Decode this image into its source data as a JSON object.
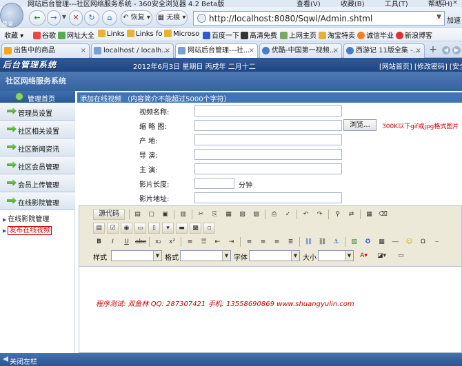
{
  "browser": {
    "window_title": "网站后台管理---社区网络服务系统 - 360安全浏览器 4.2 Beta版",
    "menus": [
      "查看(V)",
      "收藏(B)",
      "工具(T)",
      "帮助(H)"
    ],
    "logo_label": "登录",
    "restore_label": "恢复",
    "incognito_label": "无痕",
    "address": "http://localhost:8080/Sqwl/Admin.shtml",
    "address_add_label": "加速",
    "favorites_label": "收藏",
    "favorites": [
      "谷歌",
      "网址大全",
      "Links",
      "Links fo",
      "Microso",
      "百度一下",
      "高清免费",
      "上网主页",
      "淘宝特卖",
      "诚信毕业",
      "新浪博客"
    ],
    "tabs": [
      {
        "label": "出售中的商品",
        "active": false
      },
      {
        "label": "localhost / localh...",
        "active": false
      },
      {
        "label": "网站后台管理---社...",
        "active": true
      },
      {
        "label": "优酷-中国第一视频...",
        "active": false
      },
      {
        "label": "西游记 11版全集 -...",
        "active": false
      }
    ]
  },
  "header": {
    "title": "后台管理系统",
    "date": "2012年6月3日  星期日  丙戌年  二月十二",
    "links": "[网站首页] [修改密码] [安全"
  },
  "subheader": {
    "title": "社区网络服务系统"
  },
  "sidebar": {
    "home_label": "管理首页",
    "items": [
      "管理员设置",
      "社区相关设置",
      "社区新闻资讯",
      "社区会员管理",
      "会员上传管理",
      "在线影院管理"
    ],
    "subitems": [
      {
        "label": "在线影院管理",
        "current": false
      },
      {
        "label": "发布在线视频",
        "current": true
      }
    ]
  },
  "form": {
    "heading": "添加在线视频 （内容简介不能超过5000个字符）",
    "fields": {
      "name_label": "视频名称:",
      "thumb_label": "缩 略 图:",
      "browse_label": "浏览...",
      "thumb_hint": "300K以下gif或jpg格式图片",
      "origin_label": "产     地:",
      "director_label": "导     演:",
      "actor_label": "主     演:",
      "length_label": "影片长度:",
      "length_unit": "分钟",
      "url_label": "影片地址:"
    }
  },
  "editor": {
    "source_label": "源代码",
    "style_label": "样式",
    "format_label": "格式",
    "font_label": "字体",
    "size_label": "大小",
    "signature": "程序测试: 双鱼林  QQ: 287307421  手机: 13558690869  www.shuangyulin.com"
  },
  "status": {
    "close_sidebar_label": "关闭左栏"
  }
}
